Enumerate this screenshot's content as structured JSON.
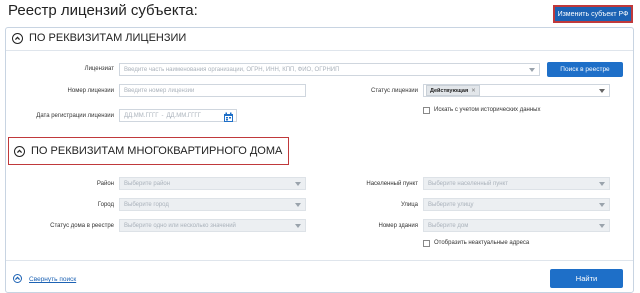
{
  "page": {
    "title": "Реестр лицензий субъекта:"
  },
  "header": {
    "change_subject_label": "Изменить субъект РФ"
  },
  "license_section": {
    "title": "ПО РЕКВИЗИТАМ ЛИЦЕНЗИИ",
    "licensee_label": "Лицензиат",
    "licensee_placeholder": "Введите часть наименования организации, ОГРН, ИНН, КПП, ФИО, ОГРНИП",
    "search_registry_label": "Поиск в реестре",
    "license_number_label": "Номер лицензии",
    "license_number_placeholder": "Введите номер лицензии",
    "license_status_label": "Статус лицензии",
    "license_status_value": "Действующая",
    "reg_date_label": "Дата регистрации лицензии",
    "date_from_placeholder": "ДД.ММ.ГГГГ",
    "date_to_placeholder": "ДД.ММ.ГГГГ",
    "date_separator": "-",
    "historical_checkbox_label": "Искать с учетом исторических данных"
  },
  "building_section": {
    "title": "ПО РЕКВИЗИТАМ МНОГОКВАРТИРНОГО ДОМА",
    "district_label": "Район",
    "district_placeholder": "Выберите район",
    "settlement_label": "Населенный пункт",
    "settlement_placeholder": "Выберите населенный пункт",
    "city_label": "Город",
    "city_placeholder": "Выберите город",
    "street_label": "Улица",
    "street_placeholder": "Выберите улицу",
    "house_status_label": "Статус дома в реестре",
    "house_status_placeholder": "Выберите одно или несколько значений",
    "building_number_label": "Номер здания",
    "building_number_placeholder": "Выберите дом",
    "irrelevant_addresses_label": "Отобразить неактуальные адреса"
  },
  "footer": {
    "collapse_label": "Свернуть поиск",
    "find_label": "Найти"
  },
  "colors": {
    "accent": "#1e6fc8",
    "highlight": "#c0393b"
  }
}
